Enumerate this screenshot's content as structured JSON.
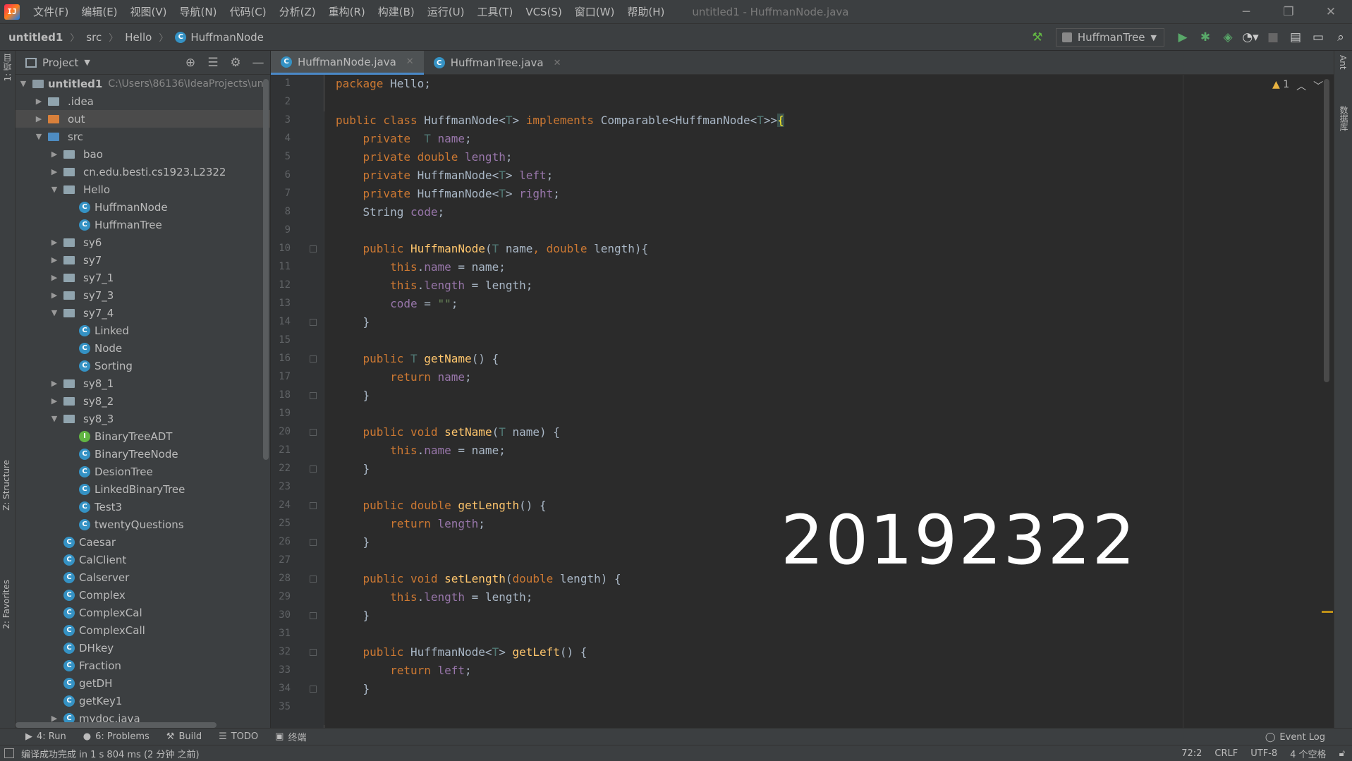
{
  "menubar": {
    "items": [
      "文件(F)",
      "编辑(E)",
      "视图(V)",
      "导航(N)",
      "代码(C)",
      "分析(Z)",
      "重构(R)",
      "构建(B)",
      "运行(U)",
      "工具(T)",
      "VCS(S)",
      "窗口(W)",
      "帮助(H)"
    ],
    "window_title": "untitled1 - HuffmanNode.java",
    "logo": "IJ"
  },
  "navbar": {
    "crumbs": [
      "untitled1",
      "src",
      "Hello",
      "HuffmanNode"
    ],
    "run_config": "HuffmanTree",
    "icons": [
      "hammer-icon",
      "run-icon",
      "debug-icon",
      "coverage-icon",
      "profile-icon",
      "stop-icon",
      "project-structure-icon",
      "layout-icon",
      "search-icon"
    ]
  },
  "left_stripe": {
    "project": "1: 项目",
    "structure": "Z: Structure",
    "favorites": "2: Favorites"
  },
  "right_stripe": {
    "ant": "Ant",
    "database": "数据库"
  },
  "project_panel": {
    "title": "Project",
    "root": {
      "name": "untitled1",
      "path": "C:\\Users\\86136\\IdeaProjects\\un"
    },
    "tree": [
      {
        "label": ".idea",
        "kind": "folder",
        "level": 1,
        "arrow": "▶"
      },
      {
        "label": "out",
        "kind": "folder-orange",
        "level": 1,
        "arrow": "▶"
      },
      {
        "label": "src",
        "kind": "folder-blue",
        "level": 1,
        "arrow": "▼"
      },
      {
        "label": "bao",
        "kind": "folder",
        "level": 2,
        "arrow": "▶"
      },
      {
        "label": "cn.edu.besti.cs1923.L2322",
        "kind": "folder",
        "level": 2,
        "arrow": "▶"
      },
      {
        "label": "Hello",
        "kind": "folder",
        "level": 2,
        "arrow": "▼"
      },
      {
        "label": "HuffmanNode",
        "kind": "class",
        "level": 3,
        "arrow": ""
      },
      {
        "label": "HuffmanTree",
        "kind": "class",
        "level": 3,
        "arrow": ""
      },
      {
        "label": "sy6",
        "kind": "folder",
        "level": 2,
        "arrow": "▶"
      },
      {
        "label": "sy7",
        "kind": "folder",
        "level": 2,
        "arrow": "▶"
      },
      {
        "label": "sy7_1",
        "kind": "folder",
        "level": 2,
        "arrow": "▶"
      },
      {
        "label": "sy7_3",
        "kind": "folder",
        "level": 2,
        "arrow": "▶"
      },
      {
        "label": "sy7_4",
        "kind": "folder",
        "level": 2,
        "arrow": "▼"
      },
      {
        "label": "Linked",
        "kind": "class",
        "level": 3,
        "arrow": ""
      },
      {
        "label": "Node",
        "kind": "class",
        "level": 3,
        "arrow": ""
      },
      {
        "label": "Sorting",
        "kind": "class",
        "level": 3,
        "arrow": ""
      },
      {
        "label": "sy8_1",
        "kind": "folder",
        "level": 2,
        "arrow": "▶"
      },
      {
        "label": "sy8_2",
        "kind": "folder",
        "level": 2,
        "arrow": "▶"
      },
      {
        "label": "sy8_3",
        "kind": "folder",
        "level": 2,
        "arrow": "▼"
      },
      {
        "label": "BinaryTreeADT",
        "kind": "interface",
        "level": 3,
        "arrow": ""
      },
      {
        "label": "BinaryTreeNode",
        "kind": "class",
        "level": 3,
        "arrow": ""
      },
      {
        "label": "DesionTree",
        "kind": "class",
        "level": 3,
        "arrow": ""
      },
      {
        "label": "LinkedBinaryTree",
        "kind": "class",
        "level": 3,
        "arrow": ""
      },
      {
        "label": "Test3",
        "kind": "class",
        "level": 3,
        "arrow": ""
      },
      {
        "label": "twentyQuestions",
        "kind": "class",
        "level": 3,
        "arrow": ""
      },
      {
        "label": "Caesar",
        "kind": "class",
        "level": 2,
        "arrow": ""
      },
      {
        "label": "CalClient",
        "kind": "class",
        "level": 2,
        "arrow": ""
      },
      {
        "label": "Calserver",
        "kind": "class",
        "level": 2,
        "arrow": ""
      },
      {
        "label": "Complex",
        "kind": "class",
        "level": 2,
        "arrow": ""
      },
      {
        "label": "ComplexCal",
        "kind": "class",
        "level": 2,
        "arrow": ""
      },
      {
        "label": "ComplexCall",
        "kind": "class",
        "level": 2,
        "arrow": ""
      },
      {
        "label": "DHkey",
        "kind": "class",
        "level": 2,
        "arrow": ""
      },
      {
        "label": "Fraction",
        "kind": "class",
        "level": 2,
        "arrow": ""
      },
      {
        "label": "getDH",
        "kind": "class",
        "level": 2,
        "arrow": ""
      },
      {
        "label": "getKey1",
        "kind": "class",
        "level": 2,
        "arrow": ""
      },
      {
        "label": "mydoc.java",
        "kind": "class",
        "level": 2,
        "arrow": "▶"
      }
    ]
  },
  "editor": {
    "tabs": [
      {
        "label": "HuffmanNode.java",
        "active": true
      },
      {
        "label": "HuffmanTree.java",
        "active": false
      }
    ],
    "warnings": "1",
    "watermark": "20192322",
    "line_numbers": [
      "1",
      "2",
      "3",
      "4",
      "5",
      "6",
      "7",
      "8",
      "9",
      "10",
      "11",
      "12",
      "13",
      "14",
      "15",
      "16",
      "17",
      "18",
      "19",
      "20",
      "21",
      "22",
      "23",
      "24",
      "25",
      "26",
      "27",
      "28",
      "29",
      "30",
      "31",
      "32",
      "33",
      "34",
      "35"
    ]
  },
  "bottom_tools": {
    "run": "4: Run",
    "problems": "6: Problems",
    "build": "Build",
    "todo": "TODO",
    "terminal": "终端",
    "event_log": "Event Log"
  },
  "statusbar": {
    "message": "编译成功完成 in 1 s 804 ms (2 分钟 之前)",
    "position": "72:2",
    "line_sep": "CRLF",
    "encoding": "UTF-8",
    "indent": "4 个空格"
  },
  "colors": {
    "keyword": "#cc7832",
    "field": "#9876aa",
    "type_param": "#507874",
    "method": "#ffc66d",
    "string": "#6a8759",
    "text": "#a9b7c6"
  }
}
